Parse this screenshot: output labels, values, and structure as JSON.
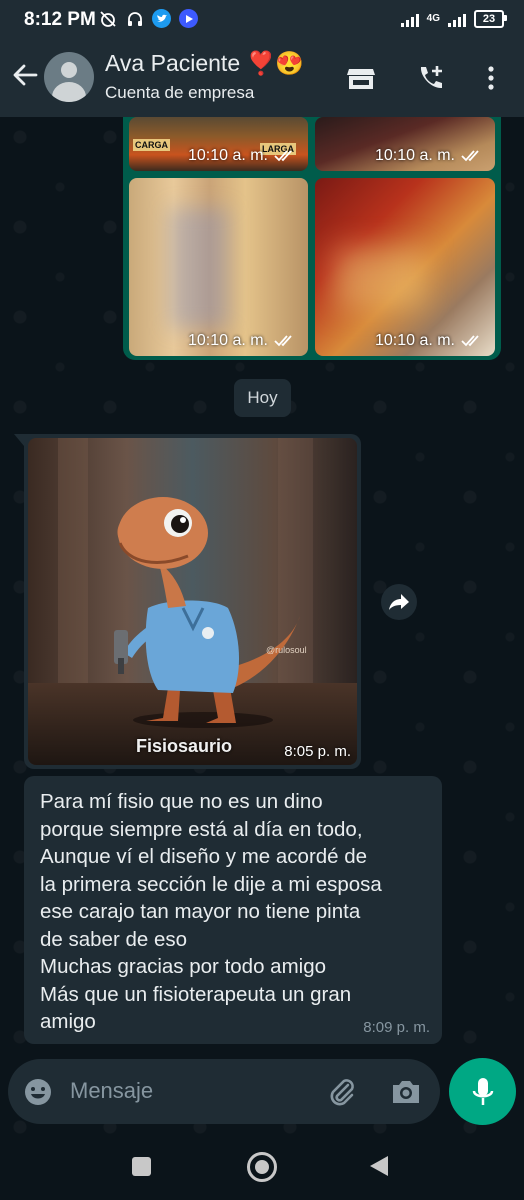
{
  "status_bar": {
    "time": "8:12 PM",
    "network": "4G",
    "battery": "23"
  },
  "header": {
    "contact_name": "Ava Paciente ❣️😍",
    "subtitle": "Cuenta de empresa"
  },
  "media_grid": {
    "items": [
      {
        "time": "10:10 a. m.",
        "banner_text": "CARGA",
        "banner_text_2": "LARGA"
      },
      {
        "time": "10:10 a. m."
      },
      {
        "time": "10:10 a. m."
      },
      {
        "time": "10:10 a. m."
      }
    ]
  },
  "date_separator": "Hoy",
  "image_message": {
    "caption": "Fisiosaurio",
    "watermark": "@rulosoul",
    "time": "8:05 p. m."
  },
  "text_message": {
    "text": "Para mí fisio que no es un dino\nporque siempre está al día en todo,\nAunque ví el diseño y me acordé de\nla primera sección le dije a mi esposa\nese carajo tan mayor no tiene pinta\nde saber de eso\nMuchas gracias por todo  amigo\nMás que un fisioterapeuta un gran\namigo",
    "time": "8:09 p. m."
  },
  "composer": {
    "placeholder": "Mensaje"
  },
  "colors": {
    "background": "#0b141a",
    "header": "#1f2c34",
    "outgoing_bubble": "#005c4b",
    "incoming_bubble": "#1f2c34",
    "accent": "#00a884",
    "read_ticks": "#ffffff"
  }
}
